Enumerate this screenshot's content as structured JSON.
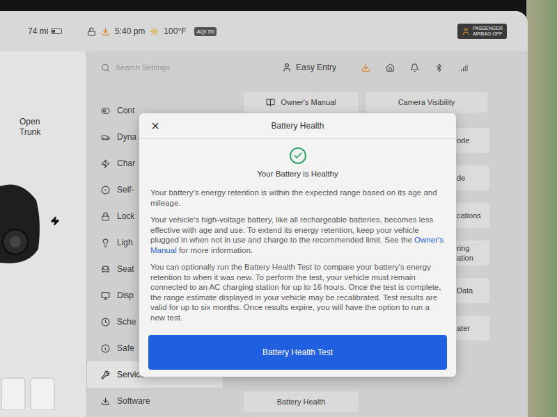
{
  "status_bar": {
    "range": "74 mi",
    "battery_level": 0.3,
    "locked": false,
    "time": "5:40 pm",
    "temperature": "100°F",
    "aqi": "AQI 55",
    "airbag_badge": [
      "PASSENGER",
      "AIRBAG OFF"
    ]
  },
  "vehicle": {
    "trunk_label": [
      "Open",
      "Trunk"
    ]
  },
  "search": {
    "placeholder": "Search Settings"
  },
  "profile": {
    "name": "Easy Entry"
  },
  "menu": [
    {
      "label": "Cont",
      "selected": false
    },
    {
      "label": "Dyna",
      "selected": false
    },
    {
      "label": "Char",
      "selected": false
    },
    {
      "label": "Self-",
      "selected": false
    },
    {
      "label": "Lock",
      "selected": false
    },
    {
      "label": "Ligh",
      "selected": false
    },
    {
      "label": "Seat",
      "selected": false
    },
    {
      "label": "Disp",
      "selected": false
    },
    {
      "label": "Sche",
      "selected": false
    },
    {
      "label": "Safe",
      "selected": false
    },
    {
      "label": "Service",
      "selected": true
    },
    {
      "label": "Software",
      "selected": false
    }
  ],
  "content": {
    "buttons": [
      "Owner's Manual",
      "Camera Visibility"
    ],
    "tiles": [
      {
        "lines": [
          "ode"
        ]
      },
      {
        "lines": [
          "de"
        ]
      },
      {
        "lines": [
          "cations"
        ]
      },
      {
        "lines": [
          "ring",
          "ation"
        ]
      },
      {
        "lines": [
          "Data"
        ]
      },
      {
        "lines": [
          "ater"
        ]
      }
    ],
    "battery_button": "Battery Health"
  },
  "dialog": {
    "title": "Battery Health",
    "close": "×",
    "status": "Your Battery is Healthy",
    "paragraphs": [
      [
        {
          "text": "Your battery's energy retention is within the expected range based on its age and mileage.",
          "link": false
        }
      ],
      [
        {
          "text": "Your vehicle's high-voltage battery, like all rechargeable batteries, becomes less effective with age and use. To extend its energy retention, keep your vehicle plugged in when not in use and charge to the recommended limit. See the ",
          "link": false
        },
        {
          "text": "Owner's Manual",
          "link": true
        },
        {
          "text": " for more information.",
          "link": false
        }
      ],
      [
        {
          "text": "You can optionally run the Battery Health Test to compare your battery's energy retention to when it was new. To perform the test, your vehicle must remain connected to an AC charging station for up to 16 hours. Once the test is complete, the range estimate displayed in your vehicle may be recalibrated. Test results are valid for up to six months. Once results expire, you will have the option to run a new test.",
          "link": false
        }
      ]
    ],
    "button": "Battery Health Test"
  }
}
